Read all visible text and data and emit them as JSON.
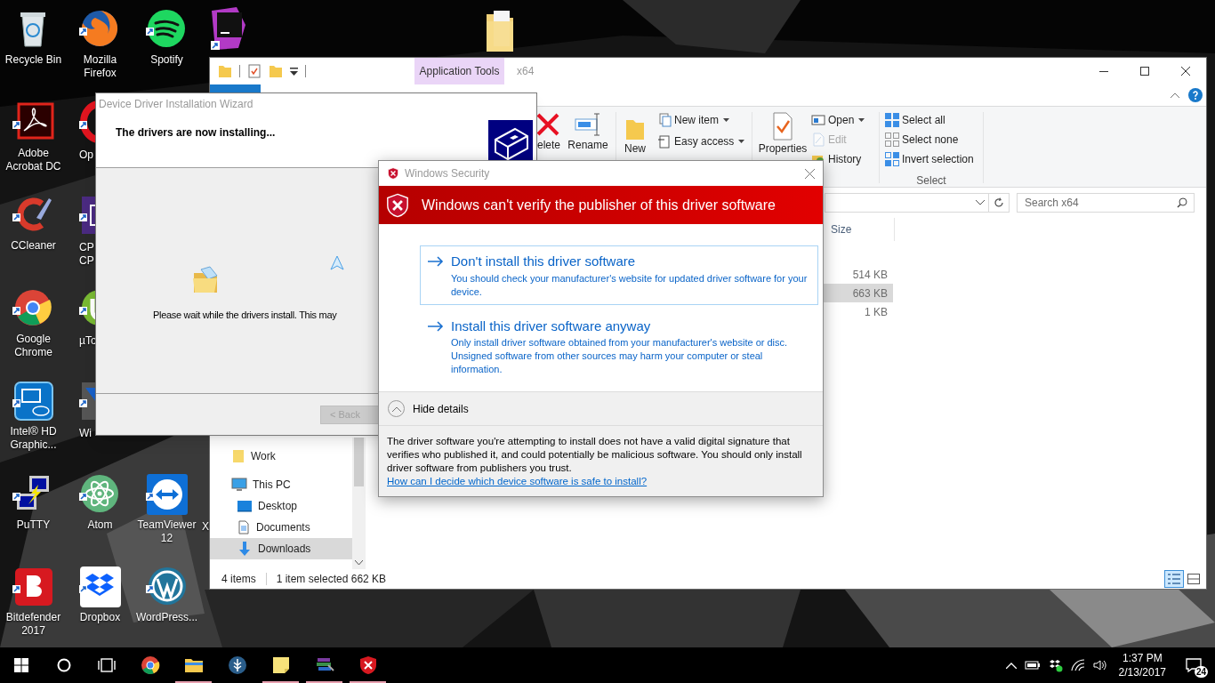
{
  "desktop_icons": [
    {
      "label": "Recycle Bin"
    },
    {
      "label": "Adobe Acrobat DC"
    },
    {
      "label": "CCleaner"
    },
    {
      "label": "Google Chrome"
    },
    {
      "label": "Intel® HD Graphic..."
    },
    {
      "label": "PuTTY"
    },
    {
      "label": "Bitdefender 2017"
    },
    {
      "label": "Mozilla Firefox"
    },
    {
      "label": "Op"
    },
    {
      "label": "CP CP"
    },
    {
      "label": "µTo"
    },
    {
      "label": "Wi"
    },
    {
      "label": "Atom"
    },
    {
      "label": "Dropbox"
    },
    {
      "label": "Spotify"
    },
    {
      "label": "TeamViewer 12"
    },
    {
      "label": "WordPress..."
    },
    {
      "label": "X"
    }
  ],
  "explorer": {
    "context_tab": "Application Tools",
    "title": "x64",
    "ribbon": {
      "delete_label": "elete",
      "rename_label": "Rename",
      "new_folder_label": "New",
      "new_items": [
        {
          "label": "New item",
          "dropdown": true
        },
        {
          "label": "Easy access",
          "dropdown": true
        }
      ],
      "properties_label": "Properties",
      "open_items": [
        {
          "label": "Open",
          "dropdown": true,
          "disabled": false
        },
        {
          "label": "Edit",
          "dropdown": false,
          "disabled": true
        },
        {
          "label": "History",
          "dropdown": false,
          "disabled": false
        }
      ],
      "select_items": [
        {
          "label": "Select all"
        },
        {
          "label": "Select none"
        },
        {
          "label": "Invert selection"
        }
      ],
      "select_group": "Select"
    },
    "search": {
      "placeholder": "Search x64"
    },
    "size_column": "Size",
    "rows": [
      {
        "size": "514 KB",
        "selected": false
      },
      {
        "size": "663 KB",
        "selected": true
      },
      {
        "size": "1 KB",
        "selected": false
      }
    ],
    "nav_tree": [
      {
        "label": "Work",
        "selected": false
      },
      {
        "label": "This PC",
        "selected": false,
        "children": [
          {
            "label": "Desktop",
            "selected": false
          },
          {
            "label": "Documents",
            "selected": false
          },
          {
            "label": "Downloads",
            "selected": true
          }
        ]
      }
    ],
    "status_bar": {
      "count": "4 items",
      "selection": "1 item selected  662 KB"
    }
  },
  "wizard": {
    "title": "Device Driver Installation Wizard",
    "heading": "The drivers are now installing...",
    "message": "Please wait while the drivers install. This may",
    "back_button": {
      "label": "< Back",
      "disabled": true
    }
  },
  "security_dialog": {
    "title": "Windows Security",
    "banner": "Windows can't verify the publisher of this driver software",
    "options": [
      {
        "title": "Don't install this driver software",
        "description": "You should check your manufacturer's website for updated driver software for your device.",
        "selected": true
      },
      {
        "title": "Install this driver software anyway",
        "description": "Only install driver software obtained from your manufacturer's website or disc. Unsigned software from other sources may harm your computer or steal information.",
        "selected": false
      }
    ],
    "details_toggle": "Hide details",
    "details": "The driver software you're attempting to install does not have a valid digital signature that verifies who published it, and could potentially be malicious software.  You should only install driver software from publishers you trust.",
    "details_link": "How can I decide which device software is safe to install?"
  },
  "taskbar": {
    "apps": [
      {
        "running": false
      },
      {
        "running": true
      },
      {
        "running": false
      },
      {
        "running": true
      },
      {
        "running": true
      },
      {
        "running": true
      }
    ],
    "time": "1:37 PM",
    "date": "2/13/2017",
    "notifications": "24"
  }
}
